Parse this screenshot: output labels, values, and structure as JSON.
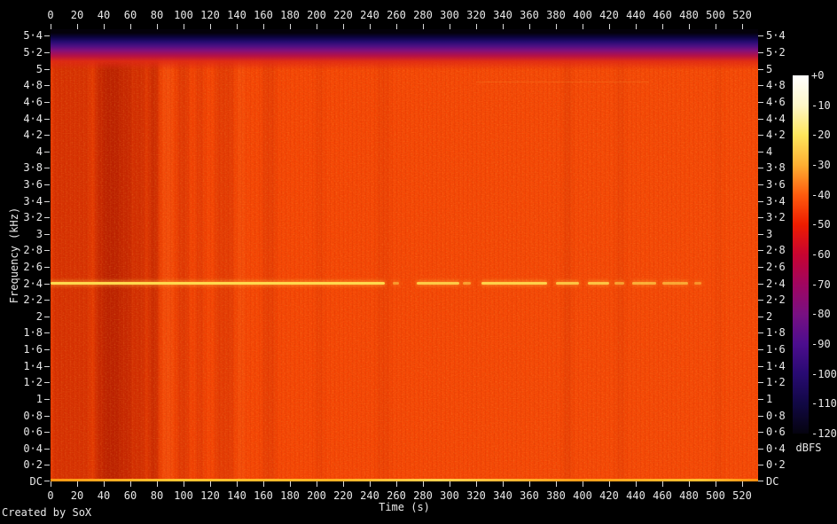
{
  "app": {
    "credit": "Created by SoX"
  },
  "axes": {
    "time": {
      "label": "Time (s)",
      "ticks": [
        0,
        20,
        40,
        60,
        80,
        100,
        120,
        140,
        160,
        180,
        200,
        220,
        240,
        260,
        280,
        300,
        320,
        340,
        360,
        380,
        400,
        420,
        440,
        460,
        480,
        500,
        520
      ]
    },
    "frequency": {
      "label": "Frequency (kHz)",
      "tick_labels": [
        "5·4",
        "5·2",
        "5",
        "4·8",
        "4·6",
        "4·4",
        "4·2",
        "4",
        "3·8",
        "3·6",
        "3·4",
        "3·2",
        "3",
        "2·8",
        "2·6",
        "2·4",
        "2·2",
        "2",
        "1·8",
        "1·6",
        "1·4",
        "1·2",
        "1",
        "0·8",
        "0·6",
        "0·4",
        "0·2",
        "DC"
      ],
      "tick_khz": [
        5.4,
        5.2,
        5.0,
        4.8,
        4.6,
        4.4,
        4.2,
        4.0,
        3.8,
        3.6,
        3.4,
        3.2,
        3.0,
        2.8,
        2.6,
        2.4,
        2.2,
        2.0,
        1.8,
        1.6,
        1.4,
        1.2,
        1.0,
        0.8,
        0.6,
        0.4,
        0.2,
        0
      ]
    }
  },
  "colorbar": {
    "label": "dBFS",
    "ticks": [
      "+0",
      "-10",
      "-20",
      "-30",
      "-40",
      "-50",
      "-60",
      "-70",
      "-80",
      "-90",
      "-100",
      "-110",
      "-120"
    ],
    "palette": [
      "#ffffff",
      "#fef7c8",
      "#ffe65c",
      "#ffaf32",
      "#ff5c0e",
      "#ee1c00",
      "#c70430",
      "#a00560",
      "#781082",
      "#4c0d8e",
      "#280a72",
      "#110844",
      "#05030f"
    ]
  },
  "chart_data": {
    "type": "heatmap",
    "subtype": "audio-spectrogram",
    "title": "",
    "xlabel": "Time (s)",
    "ylabel": "Frequency (kHz)",
    "zlabel": "dBFS",
    "x_range_s": [
      0,
      532
    ],
    "x_tick_step_s": 20,
    "y_range_khz": [
      0,
      5.48
    ],
    "y_tick_step_khz": 0.2,
    "z_range_db": [
      0,
      -120
    ],
    "background": {
      "desc": "broadband noise floor rendered orange, roughly -40 to -50 dBFS",
      "color": "#f94705"
    },
    "rolloff": {
      "desc": "low-pass rolloff above ~5.2 kHz fading through red-purple-blue to -120 dBFS (black) at the top edge",
      "start_khz": 5.2
    },
    "tone": {
      "freq_khz": 2.4,
      "desc": "narrow bright tone near -20 dBFS; continuous for first ~250 s, then intermittent dashes until ~490 s",
      "segments_s": [
        [
          0,
          251,
          1
        ],
        [
          257,
          262,
          0.55
        ],
        [
          275,
          307,
          0.9
        ],
        [
          310,
          316,
          0.6
        ],
        [
          324,
          373,
          0.95
        ],
        [
          380,
          397,
          0.85
        ],
        [
          404,
          420,
          0.85
        ],
        [
          424,
          431,
          0.6
        ],
        [
          437,
          455,
          0.7
        ],
        [
          460,
          479,
          0.65
        ],
        [
          484,
          489,
          0.5
        ]
      ]
    },
    "faint_tone": {
      "freq_khz": 4.83,
      "segments_s": [
        [
          320,
          450,
          0.15
        ]
      ]
    },
    "dc_ridge": {
      "freq_khz": 0,
      "desc": "bright orange-yellow ridge along the bottom (DC) edge",
      "span_s": [
        0,
        532
      ]
    },
    "time_bands": [
      {
        "t0": 0,
        "t1": 80,
        "alpha": 0.12,
        "shade": "dark"
      },
      {
        "t0": 2,
        "t1": 29,
        "alpha": 0.18,
        "shade": "dark"
      },
      {
        "t0": 34,
        "t1": 61,
        "alpha": 0.42,
        "shade": "dark"
      },
      {
        "t0": 40,
        "t1": 52,
        "alpha": 0.25,
        "shade": "dark"
      },
      {
        "t0": 62,
        "t1": 71,
        "alpha": 0.28,
        "shade": "dark"
      },
      {
        "t0": 74,
        "t1": 81,
        "alpha": 0.36,
        "shade": "dark"
      },
      {
        "t0": 84,
        "t1": 92,
        "alpha": 0.12,
        "shade": "light"
      },
      {
        "t0": 95,
        "t1": 104,
        "alpha": 0.2,
        "shade": "dark"
      },
      {
        "t0": 109,
        "t1": 115,
        "alpha": 0.15,
        "shade": "dark"
      },
      {
        "t0": 124,
        "t1": 138,
        "alpha": 0.18,
        "shade": "dark"
      },
      {
        "t0": 140,
        "t1": 146,
        "alpha": 0.1,
        "shade": "light"
      },
      {
        "t0": 159,
        "t1": 169,
        "alpha": 0.12,
        "shade": "dark"
      },
      {
        "t0": 199,
        "t1": 205,
        "alpha": 0.08,
        "shade": "dark"
      },
      {
        "t0": 245,
        "t1": 255,
        "alpha": 0.08,
        "shade": "dark"
      },
      {
        "t0": 385,
        "t1": 392,
        "alpha": 0.1,
        "shade": "dark"
      },
      {
        "t0": 425,
        "t1": 432,
        "alpha": 0.08,
        "shade": "dark"
      },
      {
        "t0": 500,
        "t1": 505,
        "alpha": 0.06,
        "shade": "dark"
      }
    ]
  }
}
